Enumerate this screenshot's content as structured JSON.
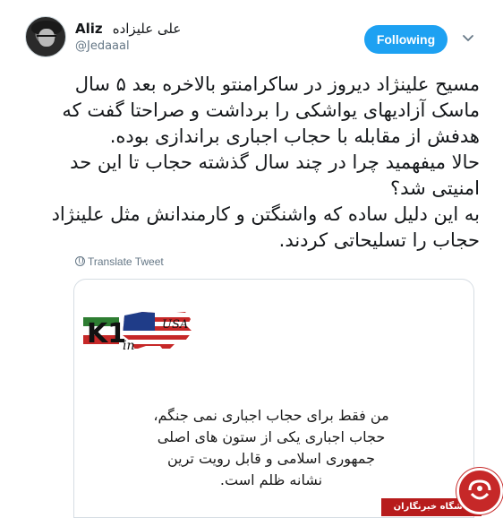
{
  "user": {
    "display_name": "Aliz",
    "display_name_fa": "علی علیزاده",
    "handle": "@Jedaaal"
  },
  "follow_button": {
    "label": "Following"
  },
  "tweet": {
    "lines": [
      "مسیح علینژاد دیروز در ساکرامنتو بالاخره بعد ۵ سال",
      "ماسک آزادیهای یواشکی را برداشت و صراحتا گفت که",
      "هدفش از مقابله با حجاب اجباری براندازی بوده.",
      "حالا میفهمید چرا در چند سال گذشته حجاب تا این حد",
      "امنیتی شد؟",
      "به این دلیل ساده که واشنگتن و کارمندانش مثل علینژاد",
      "حجاب را تسلیحاتی کردند."
    ]
  },
  "translate": {
    "label": "Translate Tweet"
  },
  "media": {
    "logo_text": "K1",
    "logo_sub": "in",
    "logo_usa": "USA",
    "quote_lines": [
      "من فقط برای حجاب اجباری نمی جنگم،",
      "حجاب اجباری یکی از ستون های اصلی",
      "جمهوری اسلامی و قابل رویت ترین",
      "نشانه ظلم است."
    ]
  },
  "watermark": {
    "text": "باشگاه خبرنگاران"
  },
  "colors": {
    "accent": "#1da1f2",
    "watermark": "#b71c1c"
  }
}
